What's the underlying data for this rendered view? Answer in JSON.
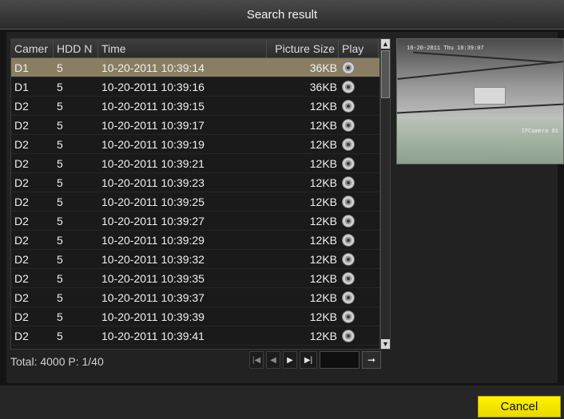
{
  "window": {
    "title": "Search result"
  },
  "table": {
    "columns": [
      "Camer",
      "HDD N",
      "Time",
      "Picture Size",
      "Play"
    ],
    "rows": [
      {
        "camera": "D1",
        "hdd": "5",
        "time": "10-20-2011 10:39:14",
        "size": "36KB",
        "selected": true
      },
      {
        "camera": "D1",
        "hdd": "5",
        "time": "10-20-2011 10:39:16",
        "size": "36KB"
      },
      {
        "camera": "D2",
        "hdd": "5",
        "time": "10-20-2011 10:39:15",
        "size": "12KB"
      },
      {
        "camera": "D2",
        "hdd": "5",
        "time": "10-20-2011 10:39:17",
        "size": "12KB"
      },
      {
        "camera": "D2",
        "hdd": "5",
        "time": "10-20-2011 10:39:19",
        "size": "12KB"
      },
      {
        "camera": "D2",
        "hdd": "5",
        "time": "10-20-2011 10:39:21",
        "size": "12KB"
      },
      {
        "camera": "D2",
        "hdd": "5",
        "time": "10-20-2011 10:39:23",
        "size": "12KB"
      },
      {
        "camera": "D2",
        "hdd": "5",
        "time": "10-20-2011 10:39:25",
        "size": "12KB"
      },
      {
        "camera": "D2",
        "hdd": "5",
        "time": "10-20-2011 10:39:27",
        "size": "12KB"
      },
      {
        "camera": "D2",
        "hdd": "5",
        "time": "10-20-2011 10:39:29",
        "size": "12KB"
      },
      {
        "camera": "D2",
        "hdd": "5",
        "time": "10-20-2011 10:39:32",
        "size": "12KB"
      },
      {
        "camera": "D2",
        "hdd": "5",
        "time": "10-20-2011 10:39:35",
        "size": "12KB"
      },
      {
        "camera": "D2",
        "hdd": "5",
        "time": "10-20-2011 10:39:37",
        "size": "12KB"
      },
      {
        "camera": "D2",
        "hdd": "5",
        "time": "10-20-2011 10:39:39",
        "size": "12KB"
      },
      {
        "camera": "D2",
        "hdd": "5",
        "time": "10-20-2011 10:39:41",
        "size": "12KB"
      }
    ]
  },
  "footer": {
    "total": "Total: 4000  P: 1/40"
  },
  "pager": {
    "first_icon": "skip-first-icon",
    "prev_icon": "prev-icon",
    "next_icon": "next-icon",
    "last_icon": "skip-last-icon",
    "go_icon": "arrow-right-icon",
    "page_value": ""
  },
  "preview": {
    "timestamp": "10-20-2011 Thu 10:39:07",
    "camera_label": "IPCamera 01"
  },
  "actions": {
    "cancel_label": "Cancel"
  },
  "colors": {
    "selected_row": "#8a7e62",
    "cancel_button": "#fff200"
  }
}
